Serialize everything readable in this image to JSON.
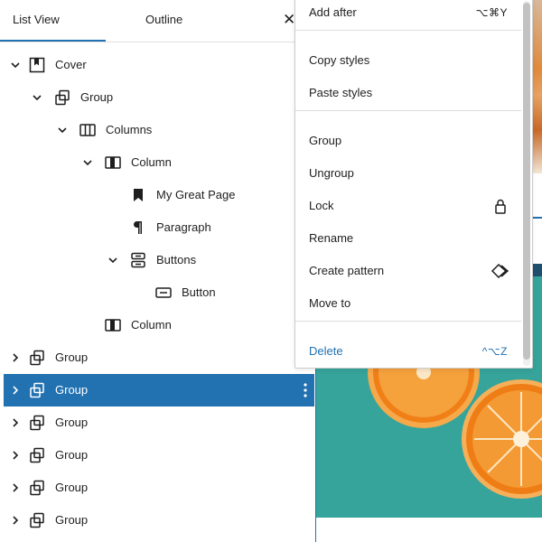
{
  "tabs": {
    "list_view": "List View",
    "outline": "Outline",
    "close": "✕"
  },
  "tree": [
    {
      "label": "Cover",
      "icon": "cover-icon",
      "expanded": true
    },
    {
      "label": "Group",
      "icon": "group-icon",
      "expanded": true
    },
    {
      "label": "Columns",
      "icon": "columns-icon",
      "expanded": true
    },
    {
      "label": "Column",
      "icon": "column-icon",
      "expanded": true
    },
    {
      "label": "My Great Page",
      "icon": "bookmark-icon"
    },
    {
      "label": "Paragraph",
      "icon": "paragraph-icon"
    },
    {
      "label": "Buttons",
      "icon": "buttons-icon",
      "expanded": true
    },
    {
      "label": "Button",
      "icon": "button-icon"
    },
    {
      "label": "Column",
      "icon": "column-icon"
    },
    {
      "label": "Group",
      "icon": "group-icon",
      "expanded": false
    },
    {
      "label": "Group",
      "icon": "group-icon",
      "expanded": false,
      "selected": true
    },
    {
      "label": "Group",
      "icon": "group-icon",
      "expanded": false
    },
    {
      "label": "Group",
      "icon": "group-icon",
      "expanded": false
    },
    {
      "label": "Group",
      "icon": "group-icon",
      "expanded": false
    },
    {
      "label": "Group",
      "icon": "group-icon",
      "expanded": false
    }
  ],
  "menu": {
    "add_after": {
      "label": "Add after",
      "shortcut": "⌥⌘Y"
    },
    "copy_styles": "Copy styles",
    "paste_styles": "Paste styles",
    "group": "Group",
    "ungroup": "Ungroup",
    "lock": {
      "label": "Lock",
      "icon": "lock-icon"
    },
    "rename": "Rename",
    "create_pattern": {
      "label": "Create pattern",
      "icon": "diamond-icon"
    },
    "move_to": "Move to",
    "delete": {
      "label": "Delete",
      "shortcut": "^⌥Z"
    }
  },
  "colors": {
    "accent": "#2271b1",
    "canvas_bg": "#36a49b",
    "orange": "#f08a1c"
  }
}
